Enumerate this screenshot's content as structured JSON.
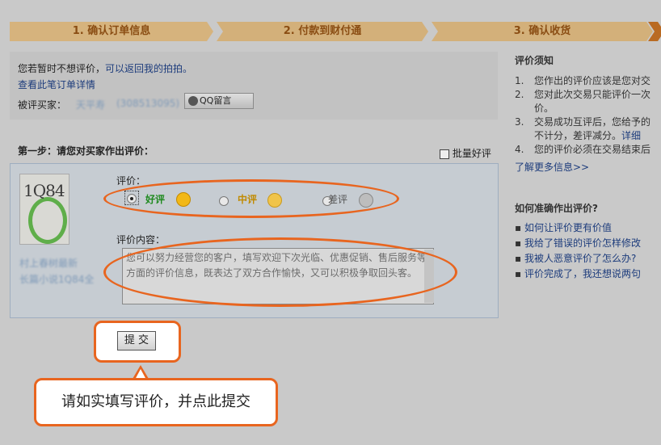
{
  "steps": [
    "1. 确认订单信息",
    "2. 付款到财付通",
    "3. 确认收货"
  ],
  "info": {
    "line1_text": "您若暂时不想评价，",
    "line1_link": "可以返回我的拍拍。",
    "order_link": "查看此笔订单详情",
    "buyer_label": "被评买家：",
    "buyer_name": "天平寿",
    "buyer_id": "(308513095)",
    "qq_button": "QQ留言"
  },
  "step1": {
    "title": "第一步：请您对买家作出评价：",
    "batch_label": "批量好评"
  },
  "product": {
    "cover_text": "1Q84",
    "name": "村上春树最新",
    "subtitle": "长篇小说1Q84全"
  },
  "rating": {
    "label": "评价：",
    "options": [
      {
        "label": "好评",
        "color": "#1f8a1f",
        "selected": true
      },
      {
        "label": "中评",
        "color": "#c08a00",
        "selected": false
      },
      {
        "label": "差评",
        "color": "#555555",
        "selected": false
      }
    ]
  },
  "content": {
    "label": "评价内容：",
    "placeholder": "您可以努力经营您的客户，填写欢迎下次光临、优惠促销、售后服务等方面的评价信息，既表达了双方合作愉快，又可以积极争取回头客。"
  },
  "submit_label": "提 交",
  "tip": "请如实填写评价，并点此提交",
  "sidebar": {
    "notice_title": "评价须知",
    "notice_items": [
      {
        "num": "1.",
        "text": "您作出的评价应该是您对交"
      },
      {
        "num": "2.",
        "text": "您对此次交易只能评价一次"
      },
      {
        "num": "",
        "text": "价。"
      },
      {
        "num": "3.",
        "text": "交易成功互评后，您给予的"
      },
      {
        "num": "",
        "text": "不计分，差评减分。"
      },
      {
        "num": "4.",
        "text": "您的评价必须在交易结束后"
      }
    ],
    "detail_link": "详细",
    "more_link": "了解更多信息>>",
    "howto_title": "如何准确作出评价?",
    "howto_links": [
      "如何让评价更有价值",
      "我给了错误的评价怎样修改",
      "我被人恶意评价了怎么办?",
      "评价完成了，我还想说两句"
    ]
  }
}
